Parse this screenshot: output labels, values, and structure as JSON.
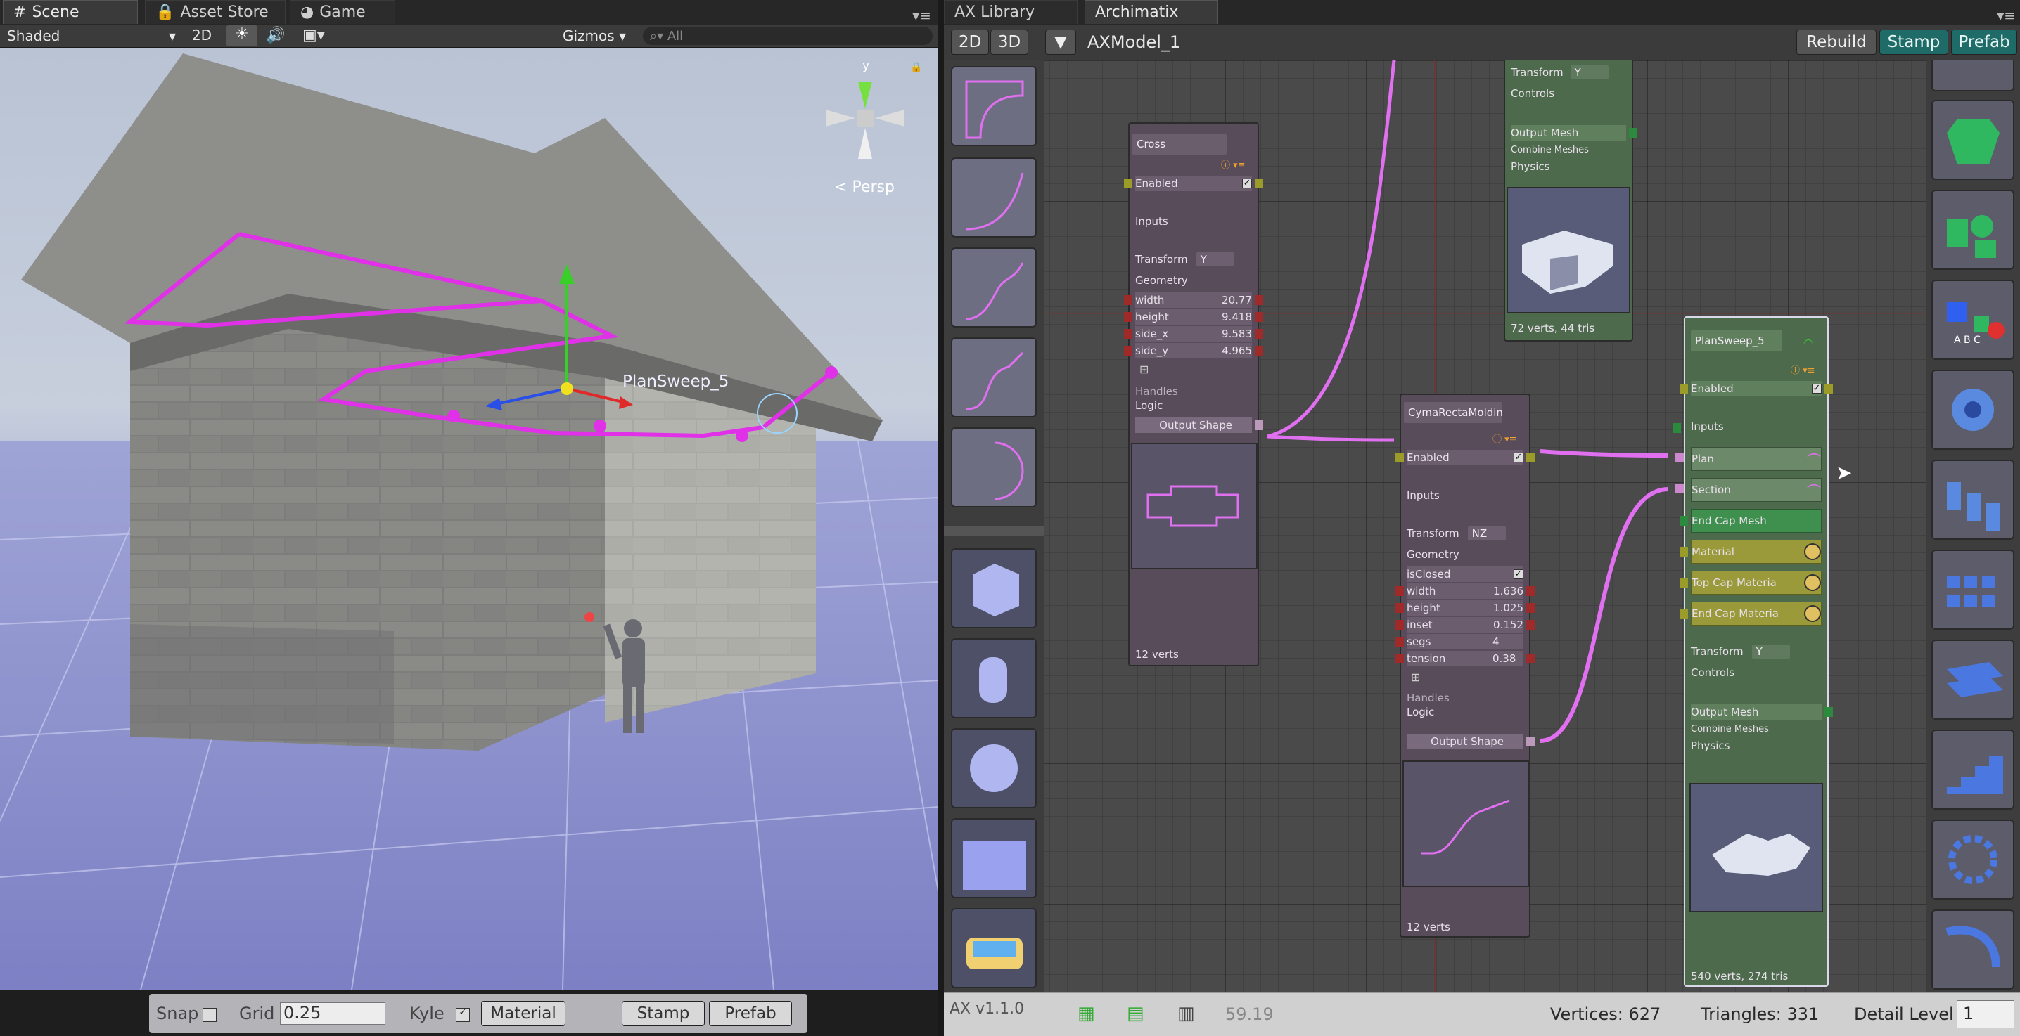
{
  "scene_tabs": [
    {
      "label": "Scene",
      "icon": "grid-icon"
    },
    {
      "label": "Asset Store",
      "icon": "lock-icon"
    },
    {
      "label": "Game",
      "icon": "pacman-icon"
    }
  ],
  "scene_toolbar": {
    "shading": "Shaded",
    "mode_2d": "2D",
    "gizmos": "Gizmos",
    "search_placeholder": "All"
  },
  "viewport": {
    "object_label": "PlanSweep_5",
    "persp_label": "Persp",
    "axis_y": "y"
  },
  "scene_bottom": {
    "snap": "Snap",
    "grid_label": "Grid",
    "grid_value": "0.25",
    "kyle": "Kyle",
    "material": "Material",
    "stamp": "Stamp",
    "prefab": "Prefab"
  },
  "ax_tabs": [
    {
      "label": "AX Library"
    },
    {
      "label": "Archimatix"
    }
  ],
  "ax_toolbar": {
    "btn_2d": "2D",
    "btn_3d": "3D",
    "model_name": "AXModel_1",
    "rebuild": "Rebuild",
    "stamp": "Stamp",
    "prefab": "Prefab"
  },
  "cross_node": {
    "title": "Cross",
    "enabled": "Enabled",
    "inputs": "Inputs",
    "transform": "Transform",
    "transform_value": "Y",
    "geometry": "Geometry",
    "params": [
      {
        "name": "width",
        "value": "20.77"
      },
      {
        "name": "height",
        "value": "9.418"
      },
      {
        "name": "side_x",
        "value": "9.583"
      },
      {
        "name": "side_y",
        "value": "4.965"
      }
    ],
    "handles": "Handles",
    "logic": "Logic",
    "output": "Output Shape",
    "footer": "12 verts"
  },
  "cyma_node": {
    "title": "CymaRectaMoldin",
    "enabled": "Enabled",
    "inputs": "Inputs",
    "transform": "Transform",
    "transform_value": "NZ",
    "geometry": "Geometry",
    "closed_label": "isClosed",
    "params": [
      {
        "name": "width",
        "value": "1.636"
      },
      {
        "name": "height",
        "value": "1.025"
      },
      {
        "name": "inset",
        "value": "0.152"
      },
      {
        "name": "segs",
        "value": "4"
      },
      {
        "name": "tension",
        "value": "0.38"
      }
    ],
    "handles": "Handles",
    "logic": "Logic",
    "output": "Output Shape",
    "footer": "12 verts"
  },
  "top_node": {
    "transform": "Transform",
    "transform_value": "Y",
    "controls": "Controls",
    "output_mesh": "Output Mesh",
    "combine": "Combine Meshes",
    "physics": "Physics",
    "footer": "72 verts, 44 tris"
  },
  "plansweep_node": {
    "title": "PlanSweep_5",
    "enabled": "Enabled",
    "inputs": "Inputs",
    "plan": "Plan",
    "section": "Section",
    "end_cap_mesh": "End Cap Mesh",
    "material": "Material",
    "top_cap": "Top Cap Materia",
    "end_cap_mat": "End Cap Materia",
    "transform": "Transform",
    "transform_value": "Y",
    "controls": "Controls",
    "output_mesh": "Output Mesh",
    "combine": "Combine Meshes",
    "physics": "Physics",
    "footer": "540 verts, 274 tris"
  },
  "status_bar": {
    "version": "AX v1.1.0",
    "fps": "59.19",
    "vertices": "Vertices: 627",
    "triangles": "Triangles: 331",
    "detail_label": "Detail Level",
    "detail_value": "1"
  }
}
